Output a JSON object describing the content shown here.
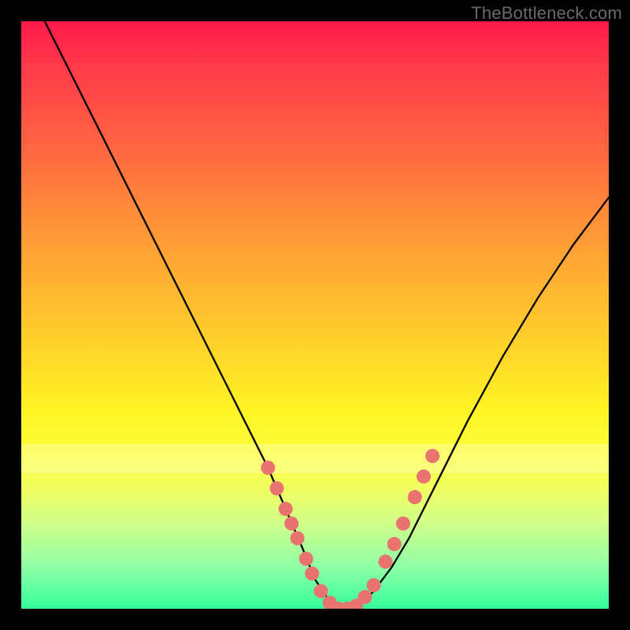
{
  "watermark": "TheBottleneck.com",
  "chart_data": {
    "type": "line",
    "title": "",
    "xlabel": "",
    "ylabel": "",
    "xlim": [
      0,
      100
    ],
    "ylim": [
      0,
      100
    ],
    "series": [
      {
        "name": "curve",
        "x": [
          4,
          10,
          16,
          22,
          28,
          34,
          38,
          42,
          45,
          48,
          50,
          52,
          54,
          56,
          58,
          60,
          63,
          66,
          70,
          76,
          82,
          88,
          94,
          100
        ],
        "values": [
          100,
          88,
          76,
          64,
          52,
          40,
          32,
          24,
          17,
          10,
          5,
          2,
          0,
          0,
          1,
          3,
          7,
          12,
          20,
          32,
          43,
          53,
          62,
          70
        ]
      }
    ],
    "markers": {
      "name": "highlight-dots",
      "color": "#e8736f",
      "points": [
        {
          "x": 42,
          "y": 24
        },
        {
          "x": 43.5,
          "y": 20.5
        },
        {
          "x": 45,
          "y": 17
        },
        {
          "x": 46,
          "y": 14.5
        },
        {
          "x": 47,
          "y": 12
        },
        {
          "x": 48.5,
          "y": 8.5
        },
        {
          "x": 49.5,
          "y": 6
        },
        {
          "x": 51,
          "y": 3
        },
        {
          "x": 52.5,
          "y": 1
        },
        {
          "x": 54,
          "y": 0
        },
        {
          "x": 55.5,
          "y": 0
        },
        {
          "x": 57,
          "y": 0.5
        },
        {
          "x": 58.5,
          "y": 2
        },
        {
          "x": 60,
          "y": 4
        },
        {
          "x": 62,
          "y": 8
        },
        {
          "x": 63.5,
          "y": 11
        },
        {
          "x": 65,
          "y": 14.5
        },
        {
          "x": 67,
          "y": 19
        },
        {
          "x": 68.5,
          "y": 22.5
        },
        {
          "x": 70,
          "y": 26
        }
      ]
    },
    "pale_bands_y": [
      {
        "from": 72,
        "to": 77
      }
    ]
  }
}
